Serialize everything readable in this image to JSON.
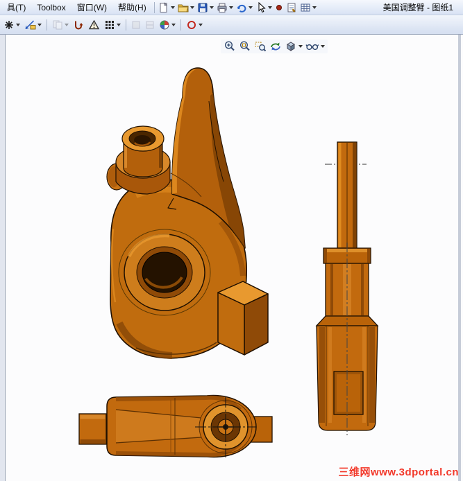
{
  "window": {
    "title": "美国调整臂 - 图纸1"
  },
  "menubar": {
    "items": [
      {
        "label": "具(T)"
      },
      {
        "label": "Toolbox"
      },
      {
        "label": "窗口(W)"
      },
      {
        "label": "帮助(H)"
      }
    ]
  },
  "standard_toolbar": {
    "icons": [
      "new-document-icon",
      "open-folder-icon",
      "save-icon",
      "print-icon",
      "undo-icon",
      "select-pointer-icon",
      "record-dot-icon",
      "sheet-properties-icon",
      "table-grid-icon"
    ]
  },
  "drawing_toolbar": {
    "icons": [
      "annotation-star-icon",
      "smart-dimension-icon",
      "copy-icon",
      "model-items-icon",
      "warning-triangle-icon",
      "dot-grid-icon",
      "disabled-tool-icon",
      "disabled-tool2-icon",
      "edit-color-icon",
      "draw-circle-icon"
    ]
  },
  "view_toolbar": {
    "icons": [
      "zoom-in-icon",
      "zoom-fit-icon",
      "zoom-area-icon",
      "rotate-view-icon",
      "shaded-cube-icon",
      "eyeglasses-icon"
    ]
  },
  "canvas": {
    "watermark": "三维网www.3dportal.cn",
    "views": [
      "isometric-view",
      "side-view",
      "bottom-view"
    ],
    "part_colors": {
      "main": "#C06C0E",
      "light": "#E8992F",
      "highlight": "#E08C20",
      "dark": "#8F4A07",
      "shadow": "#5A3004",
      "hole": "#241200"
    }
  }
}
